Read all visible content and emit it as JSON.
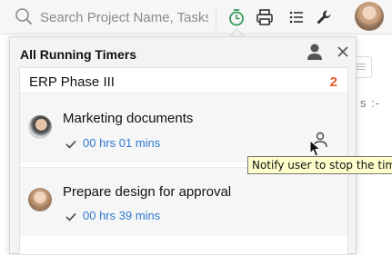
{
  "topbar": {
    "search_placeholder": "Search Project Name, Tasks...",
    "icons": [
      "search-icon",
      "timer-icon",
      "printer-icon",
      "list-icon",
      "wrench-icon",
      "avatar"
    ]
  },
  "background": {
    "text": "s :-"
  },
  "panel": {
    "title": "All Running Timers",
    "project": {
      "name": "ERP Phase III",
      "count": "2"
    },
    "tasks": [
      {
        "title": "Marketing documents",
        "time": "00 hrs 01 mins"
      },
      {
        "title": "Prepare design for approval",
        "time": "00 hrs 39 mins"
      }
    ]
  },
  "tooltip": {
    "text": "Notify user to stop the timer"
  },
  "colors": {
    "count": "#e85d2c",
    "time": "#2f7ad0",
    "tooltip_bg": "#ffffcc"
  }
}
